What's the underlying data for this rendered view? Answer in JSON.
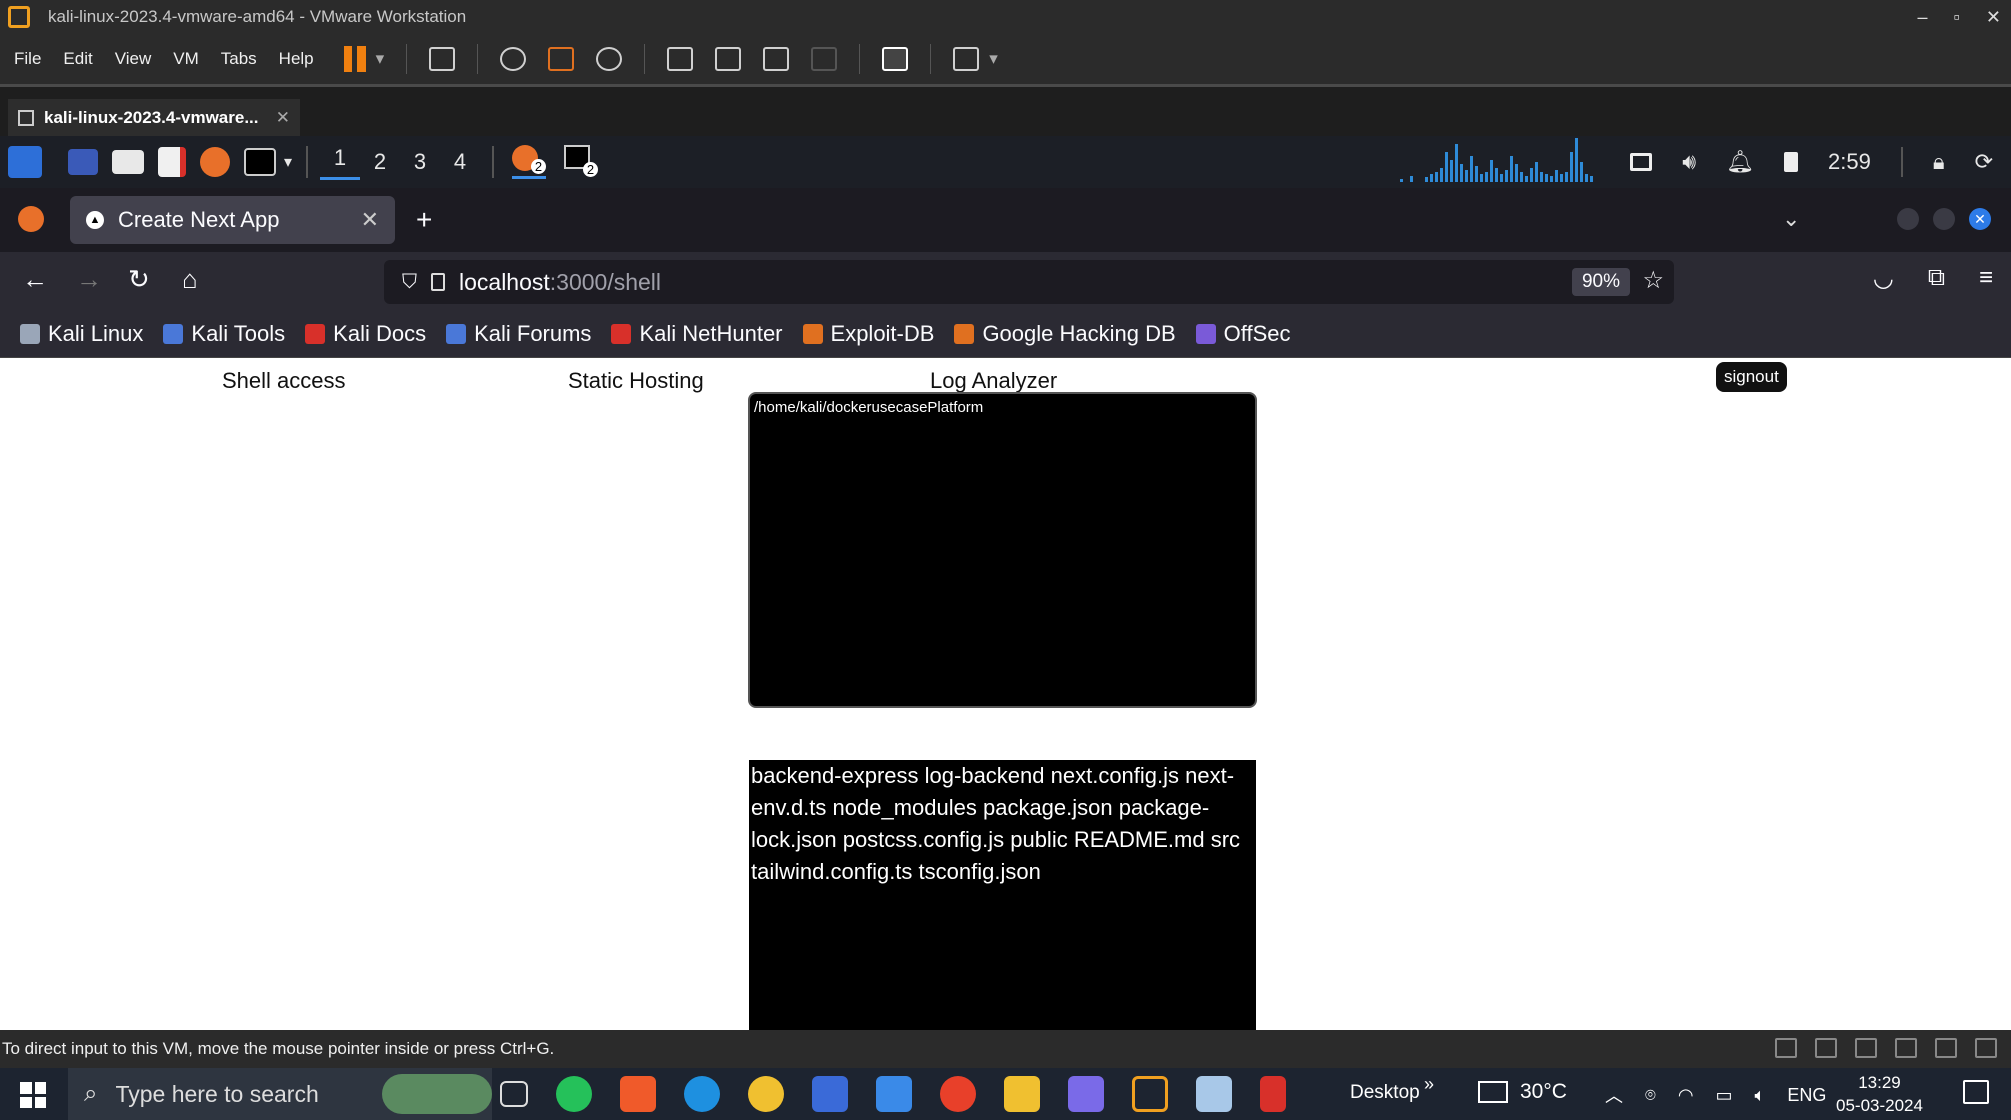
{
  "vmware": {
    "title": "kali-linux-2023.4-vmware-amd64 - VMware Workstation",
    "window_controls": [
      "–",
      "▫",
      "✕"
    ],
    "menu": [
      "File",
      "Edit",
      "View",
      "VM",
      "Tabs",
      "Help"
    ],
    "tab_label": "kali-linux-2023.4-vmware...",
    "status_text": "To direct input to this VM, move the mouse pointer inside or press Ctrl+G."
  },
  "kali_panel": {
    "workspaces": [
      "1",
      "2",
      "3",
      "4"
    ],
    "time": "2:59",
    "badge_count": "2"
  },
  "firefox": {
    "tab_title": "Create Next App",
    "url_host": "localhost",
    "url_path": ":3000/shell",
    "zoom": "90%",
    "bookmarks": [
      {
        "label": "Kali Linux",
        "color": "#9aa6b8"
      },
      {
        "label": "Kali Tools",
        "color": "#4a78d8"
      },
      {
        "label": "Kali Docs",
        "color": "#d8302a"
      },
      {
        "label": "Kali Forums",
        "color": "#4a78d8"
      },
      {
        "label": "Kali NetHunter",
        "color": "#d8302a"
      },
      {
        "label": "Exploit-DB",
        "color": "#e07020"
      },
      {
        "label": "Google Hacking DB",
        "color": "#e07020"
      },
      {
        "label": "OffSec",
        "color": "#7a5ad8"
      }
    ]
  },
  "app": {
    "nav": [
      "Shell access",
      "Static Hosting",
      "Log Analyzer"
    ],
    "signout_label": "signout",
    "terminal_value": "/home/kali/dockerusecasePlatform",
    "output_text": "backend-express log-backend next.config.js next-env.d.ts node_modules package.json package-lock.json postcss.config.js public README.md src tailwind.config.ts tsconfig.json"
  },
  "taskbar": {
    "search_placeholder": "Type here to search",
    "desktop_label": "Desktop",
    "temperature": "30°C",
    "language": "ENG",
    "time": "13:29",
    "date": "05-03-2024"
  }
}
